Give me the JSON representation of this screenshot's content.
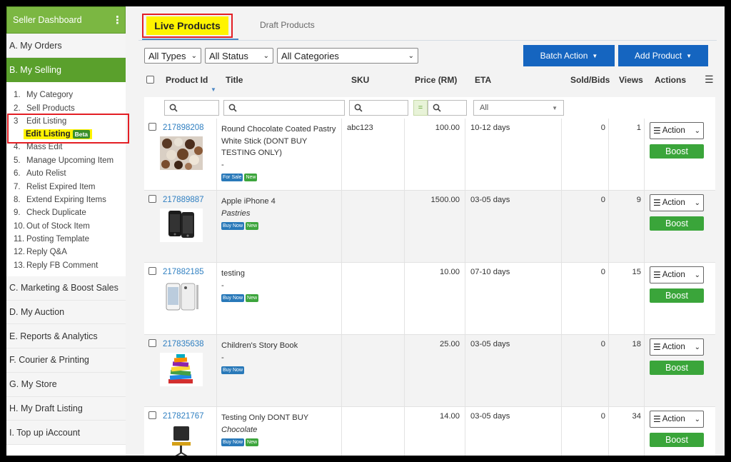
{
  "sidebar": {
    "header": "Seller Dashboard",
    "header_menu_icon": "more-vertical-icon",
    "sections_top": [
      {
        "label": "A. My Orders"
      },
      {
        "label": "B. My Selling",
        "active": true
      }
    ],
    "selling_items": [
      {
        "num": "1.",
        "label": "My Category"
      },
      {
        "num": "2.",
        "label": "Sell Products"
      },
      {
        "num": "3",
        "label": "Edit Listing"
      },
      {
        "num": "4.",
        "label": "Mass Edit"
      },
      {
        "num": "5.",
        "label": "Manage Upcoming Item"
      },
      {
        "num": "6.",
        "label": "Auto Relist"
      },
      {
        "num": "7.",
        "label": "Relist Expired Item"
      },
      {
        "num": "8.",
        "label": "Extend Expiring Items"
      },
      {
        "num": "9.",
        "label": "Check Duplicate"
      },
      {
        "num": "10.",
        "label": "Out of Stock Item"
      },
      {
        "num": "11.",
        "label": "Posting Template"
      },
      {
        "num": "12.",
        "label": "Reply Q&A"
      },
      {
        "num": "13.",
        "label": "Reply FB Comment"
      }
    ],
    "edit_listing_sub": {
      "label": "Edit Listing",
      "badge": "Beta"
    },
    "sections_bottom": [
      {
        "label": "C. Marketing & Boost Sales"
      },
      {
        "label": "D. My Auction"
      },
      {
        "label": "E. Reports & Analytics"
      },
      {
        "label": "F. Courier & Printing"
      },
      {
        "label": "G. My Store"
      },
      {
        "label": "H. My Draft Listing"
      },
      {
        "label": "I.  Top up iAccount"
      }
    ],
    "colors": {
      "header": "#7bb742",
      "active": "#5aa02c",
      "highlight": "#fff400",
      "callout": "#e31e24"
    }
  },
  "tabs": {
    "live": "Live Products",
    "draft": "Draft Products"
  },
  "filters": {
    "types": "All Types",
    "status": "All Status",
    "categories": "All Categories"
  },
  "buttons": {
    "batch": "Batch Action",
    "add": "Add Product",
    "color": "#1565c0"
  },
  "table": {
    "headers": {
      "product_id": "Product Id",
      "title": "Title",
      "sku": "SKU",
      "price": "Price (RM)",
      "eta": "ETA",
      "sold": "Sold/Bids",
      "views": "Views",
      "actions": "Actions"
    },
    "eta_filter": "All",
    "price_eq": "=",
    "rows": [
      {
        "id": "217898208",
        "title": "Round Chocolate Coated Pastry White Stick (DONT BUY TESTING ONLY)",
        "subtitle": "-",
        "badges": [
          {
            "text": "For Sale",
            "color": "blue"
          },
          {
            "text": "New",
            "color": "green"
          }
        ],
        "sku": "abc123",
        "price": "100.00",
        "eta": "10-12 days",
        "sold": "0",
        "views": "1",
        "thumb": "chocolates"
      },
      {
        "id": "217889887",
        "title": "Apple iPhone 4",
        "subtitle": "Pastries",
        "badges": [
          {
            "text": "Buy Now",
            "color": "blue"
          },
          {
            "text": "New",
            "color": "green"
          }
        ],
        "sku": "",
        "price": "1500.00",
        "eta": "03-05 days",
        "sold": "0",
        "views": "9",
        "thumb": "iphone-black"
      },
      {
        "id": "217882185",
        "title": "testing",
        "subtitle": "-",
        "badges": [
          {
            "text": "Buy Now",
            "color": "blue"
          },
          {
            "text": "New",
            "color": "green"
          }
        ],
        "sku": "",
        "price": "10.00",
        "eta": "07-10 days",
        "sold": "0",
        "views": "15",
        "thumb": "iphone-white"
      },
      {
        "id": "217835638",
        "title": "Children's Story Book",
        "subtitle": "-",
        "badges": [
          {
            "text": "Buy Now",
            "color": "blue"
          }
        ],
        "sku": "",
        "price": "25.00",
        "eta": "03-05 days",
        "sold": "0",
        "views": "18",
        "thumb": "books"
      },
      {
        "id": "217821767",
        "title": "Testing Only DONT BUY",
        "subtitle": "Chocolate",
        "badges": [
          {
            "text": "Buy Now",
            "color": "blue"
          },
          {
            "text": "New",
            "color": "green"
          }
        ],
        "sku": "",
        "price": "14.00",
        "eta": "03-05 days",
        "sold": "0",
        "views": "34",
        "thumb": "chair"
      }
    ],
    "action_label": "Action",
    "boost_label": "Boost"
  }
}
